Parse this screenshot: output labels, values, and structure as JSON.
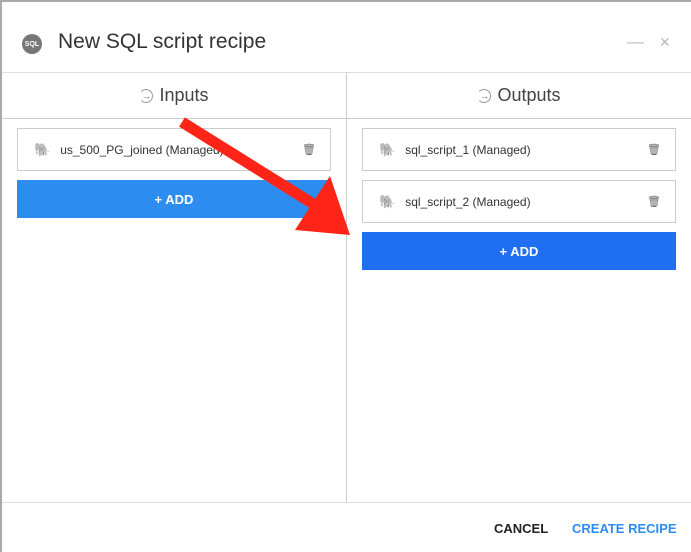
{
  "dialog": {
    "logo_text": "SQL",
    "title": "New SQL script recipe",
    "minimize": "—",
    "close": "✕"
  },
  "inputs": {
    "header": "Inputs",
    "items": [
      {
        "label": "us_500_PG_joined (Managed)"
      }
    ],
    "add_label": "+ ADD",
    "add_color": "#2d8cf0"
  },
  "outputs": {
    "header": "Outputs",
    "items": [
      {
        "label": "sql_script_1 (Managed)"
      },
      {
        "label": "sql_script_2 (Managed)"
      }
    ],
    "add_label": "+ ADD",
    "add_color": "#1f6ff0"
  },
  "footer": {
    "cancel": "CANCEL",
    "create": "CREATE RECIPE",
    "create_color": "#2d8cf0"
  },
  "annotation_color": "#ff2418"
}
